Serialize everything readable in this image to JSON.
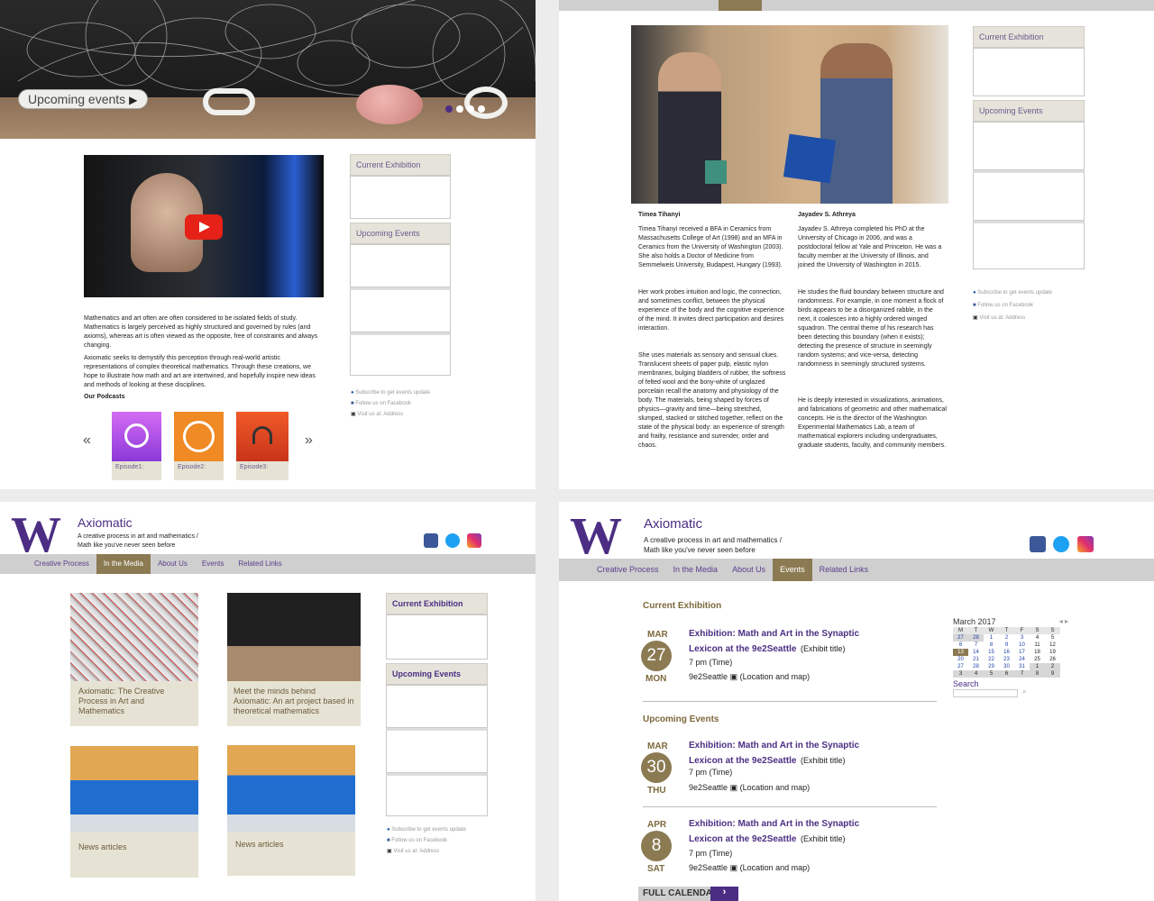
{
  "site": {
    "name": "Axiomatic",
    "tagline1": "A creative process in art and mathematics /",
    "tagline2": "Math like you've never seen before"
  },
  "nav": [
    "Creative Process",
    "In the Media",
    "About Us",
    "Events",
    "Related Links"
  ],
  "sidebar": {
    "current_exhibition": "Current Exhibition",
    "upcoming_events": "Upcoming Events",
    "subscribe": "Subscribe to get events update",
    "facebook": "Follow us on Facebook",
    "address": "Visit us at: Address"
  },
  "panel1": {
    "hero_button": "Upcoming events",
    "intro1": "Mathematics and art often are often considered to be isolated fields of study. Mathematics is largely perceived as highly structured and governed by rules (and axioms), whereas art is often viewed as the opposite, free of constraints and always changing.",
    "intro2": "Axiomatic seeks to demystify this perception through real-world artistic representations of complex theoretical mathematics. Through these creations, we hope to illustrate how math and art are intertwined, and hopefully inspire new ideas and methods of looking at these disciplines.",
    "podcasts_heading": "Our Podcasts",
    "episodes": [
      "Episode1:",
      "Episode2:",
      "Episode3:"
    ],
    "prev": "«",
    "next": "»"
  },
  "panel2": {
    "name1": "Timea Tihanyi",
    "bio1a": "Timea Tihanyi received a BFA in Ceramics from Massachusetts College of Art (1998) and an MFA in Ceramics from the University of Washington (2003). She also holds a Doctor of Medicine from Semmelweis University, Budapest, Hungary (1993).",
    "bio1b": "Her work probes intuition and logic, the connection, and sometimes conflict, between the physical experience of the body and the cognitive experience of the mind. It invites direct participation and desires interaction.",
    "bio1c": "She uses materials as sensory and sensual clues. Translucent sheets of paper pulp, elastic nylon membranes, bulging bladders of rubber, the softness of felted wool and the bony-white of unglazed porcelain recall the anatomy and physiology of the body. The materials, being shaped by forces of physics—gravity and time—being stretched, slumped, stacked or stitched together, reflect on the state of the physical body: an experience of strength and frailty, resistance and surrender, order and chaos.",
    "name2": "Jayadev S. Athreya",
    "bio2a": "Jayadev S. Athreya completed his PhD at the University of Chicago in 2006, and was a postdoctoral fellow at Yale and Princeton. He was a faculty member at the University of Illinois, and joined the University of Washington in 2015.",
    "bio2b": "He studies the fluid boundary between structure and randomness. For example, in one moment a flock of birds appears to be a disorganized rabble, in the next, it coalesces into a highly ordered winged squadron. The central theme of his research has been detecting this boundary (when it exists); detecting the presence of structure in seemingly random systems; and vice-versa, detecting randomness in seemingly structured systems.",
    "bio2c": "He is deeply interested in visualizations, animations, and fabrications of geometric and other mathematical concepts. He is the director of the Washington Experimental Mathematics Lab, a team of mathematical explorers including undergraduates, graduate students, faculty, and community members."
  },
  "panel3": {
    "cards": [
      "Axiomatic: The Creative Process in Art and Mathematics",
      "Meet the minds behind Axiomatic: An art project based in theoretical mathematics",
      "News articles",
      "News articles"
    ]
  },
  "panel4": {
    "current_heading": "Current Exhibition",
    "upcoming_heading": "Upcoming Events",
    "events": [
      {
        "month": "MAR",
        "day": "27",
        "weekday": "MON",
        "title1": "Exhibition: Math and Art in the Synaptic",
        "title2": "Lexicon at the 9e2Seattle",
        "suffix": "(Exhibit title)",
        "time": "7 pm",
        "time_note": "(Time)",
        "location": "9e2Seattle",
        "loc_note": "(Location and map)"
      },
      {
        "month": "MAR",
        "day": "30",
        "weekday": "THU",
        "title1": "Exhibition: Math and Art in the Synaptic",
        "title2": "Lexicon at the 9e2Seattle",
        "suffix": "(Exhibit title)",
        "time": "7 pm",
        "time_note": "(Time)",
        "location": "9e2Seattle",
        "loc_note": "(Location and map)"
      },
      {
        "month": "APR",
        "day": "8",
        "weekday": "SAT",
        "title1": "Exhibition: Math and Art in the Synaptic",
        "title2": "Lexicon at the 9e2Seattle",
        "suffix": "(Exhibit title)",
        "time": "7 pm",
        "time_note": "(Time)",
        "location": "9e2Seattle",
        "loc_note": "(Location and map)"
      }
    ],
    "full_calendar": "FULL CALENDAR",
    "calendar_title": "March 2017",
    "calendar_days": [
      "M",
      "T",
      "W",
      "T",
      "F",
      "S",
      "S"
    ],
    "calendar_rows": [
      [
        "27",
        "28",
        "1",
        "2",
        "3",
        "4",
        "5"
      ],
      [
        "6",
        "7",
        "8",
        "9",
        "10",
        "11",
        "12"
      ],
      [
        "13",
        "14",
        "15",
        "16",
        "17",
        "18",
        "19"
      ],
      [
        "20",
        "21",
        "22",
        "23",
        "24",
        "25",
        "26"
      ],
      [
        "27",
        "28",
        "29",
        "30",
        "31",
        "1",
        "2"
      ],
      [
        "3",
        "4",
        "5",
        "6",
        "7",
        "8",
        "9"
      ]
    ],
    "search_label": "Search"
  },
  "colors": {
    "purple": "#4b2e83",
    "gold": "#8b7a52"
  }
}
